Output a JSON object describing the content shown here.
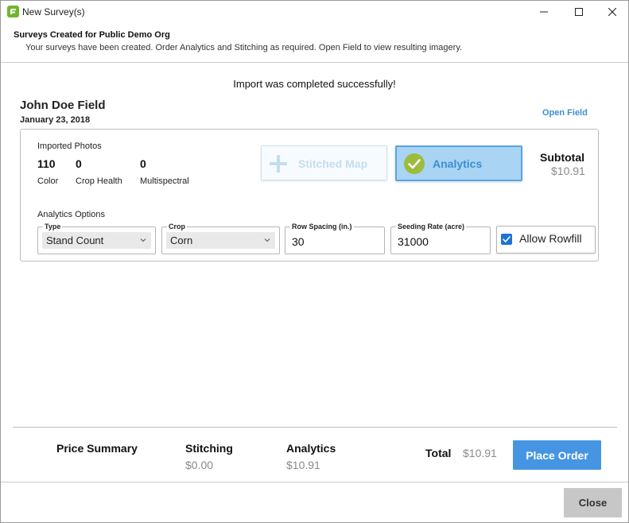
{
  "window": {
    "title": "New Survey(s)"
  },
  "header": {
    "title": "Surveys Created for Public Demo Org",
    "subtitle": "Your surveys have been created. Order Analytics and Stitching as required. Open Field to view resulting imagery."
  },
  "import_message": "Import was completed successfully!",
  "field": {
    "name": "John Doe Field",
    "date": "January 23, 2018",
    "open_field_label": "Open Field"
  },
  "survey": {
    "imported_photos_title": "Imported Photos",
    "photo_counts": [
      {
        "value": "110",
        "label": "Color"
      },
      {
        "value": "0",
        "label": "Crop Health"
      },
      {
        "value": "0",
        "label": "Multispectral"
      }
    ],
    "stitched_map_label": "Stitched Map",
    "analytics_label": "Analytics",
    "subtotal_label": "Subtotal",
    "subtotal_value": "$10.91",
    "analytics_options_title": "Analytics Options",
    "type": {
      "legend": "Type",
      "value": "Stand Count"
    },
    "crop": {
      "legend": "Crop",
      "value": "Corn"
    },
    "row_spacing": {
      "legend": "Row Spacing (in.)",
      "value": "30"
    },
    "seeding_rate": {
      "legend": "Seeding Rate (acre)",
      "value": "31000"
    },
    "allow_rowfill_label": "Allow Rowfill",
    "allow_rowfill_checked": true
  },
  "summary": {
    "title": "Price Summary",
    "stitching_label": "Stitching",
    "stitching_value": "$0.00",
    "analytics_label": "Analytics",
    "analytics_value": "$10.91",
    "total_label": "Total",
    "total_value": "$10.91",
    "place_order_label": "Place Order"
  },
  "footer": {
    "close_label": "Close"
  },
  "colors": {
    "accent": "#4595e2",
    "analytics_selected_bg": "#a9d4f3",
    "check_green": "#9dbb3c",
    "checkbox_blue": "#1e72d6"
  }
}
